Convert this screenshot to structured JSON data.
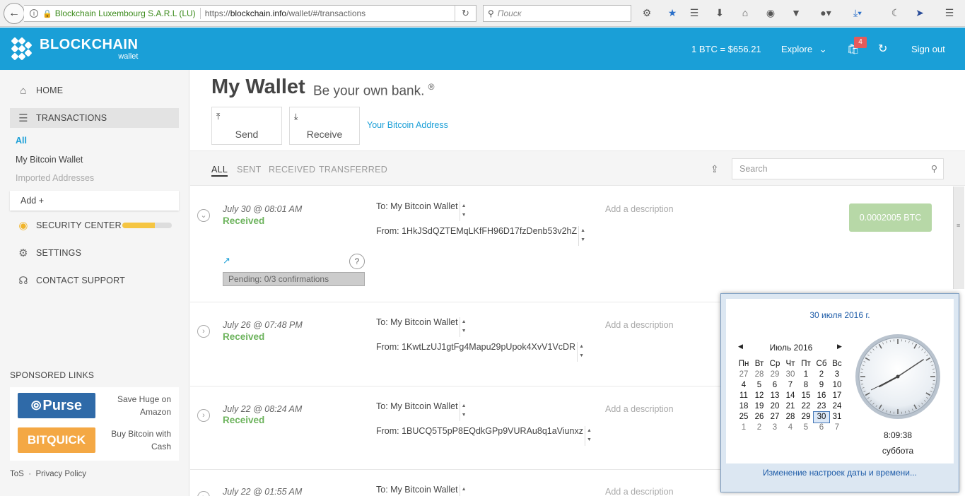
{
  "browser": {
    "org_label": "Blockchain Luxembourg S.A.R.L (LU)",
    "url_prefix": "https://",
    "url_domain": "blockchain.info",
    "url_path": "/wallet/#/transactions",
    "search_placeholder": "Поиск"
  },
  "header": {
    "brand": "BLOCKCHAIN",
    "brand_sub": "wallet",
    "price": "1 BTC =  $656.21",
    "explore": "Explore",
    "notifications": "4",
    "signout": "Sign out",
    "brand_color": "#1a9fd7"
  },
  "sidebar": {
    "home": "HOME",
    "transactions": "TRANSACTIONS",
    "sub_all": "All",
    "sub_wallet": "My Bitcoin Wallet",
    "sub_imported": "Imported Addresses",
    "add": "Add +",
    "security": "SECURITY CENTER",
    "security_progress": 0.65,
    "settings": "SETTINGS",
    "support": "CONTACT SUPPORT",
    "sponsored": "SPONSORED LINKS",
    "ad1_logo": "Purse",
    "ad1_text": "Save Huge on Amazon",
    "ad2_logo": "BITQUICK",
    "ad2_text": "Buy Bitcoin with Cash",
    "tos": "ToS",
    "privacy": "Privacy Policy"
  },
  "main": {
    "title": "My Wallet",
    "subtitle": "Be your own bank.",
    "registered": "®",
    "send": "Send",
    "receive": "Receive",
    "your_address": "Your Bitcoin Address",
    "filters": [
      "ALL",
      "SENT",
      "RECEIVED",
      "TRANSFERRED"
    ],
    "search_placeholder": "Search"
  },
  "transactions": [
    {
      "date": "July 30 @ 08:01 AM",
      "status": "Received",
      "to": "To: My Bitcoin Wallet",
      "from": "From: 1HkJSdQZTEMqLKfFH96D17fzDenb53v2hZ",
      "desc": "Add a description",
      "amount": "0.0002005 BTC",
      "pending": "Pending: 0/3 confirmations"
    },
    {
      "date": "July 26 @ 07:48 PM",
      "status": "Received",
      "to": "To: My Bitcoin Wallet",
      "from": "From: 1KwtLzUJ1gtFg4Mapu29pUpok4XvV1VcDR",
      "desc": "Add a description"
    },
    {
      "date": "July 22 @ 08:24 AM",
      "status": "Received",
      "to": "To: My Bitcoin Wallet",
      "from": "From: 1BUCQ5T5pP8EQdkGPp9VURAu8q1aViunxz",
      "desc": "Add a description"
    },
    {
      "date": "July 22 @ 01:55 AM",
      "to": "To: My Bitcoin Wallet",
      "desc": "Add a description"
    }
  ],
  "calendar": {
    "full_date": "30 июля 2016 г.",
    "month": "Июль 2016",
    "weekdays": [
      "Пн",
      "Вт",
      "Ср",
      "Чт",
      "Пт",
      "Сб",
      "Вс"
    ],
    "weeks": [
      [
        "27",
        "28",
        "29",
        "30",
        "1",
        "2",
        "3"
      ],
      [
        "4",
        "5",
        "6",
        "7",
        "8",
        "9",
        "10"
      ],
      [
        "11",
        "12",
        "13",
        "14",
        "15",
        "16",
        "17"
      ],
      [
        "18",
        "19",
        "20",
        "21",
        "22",
        "23",
        "24"
      ],
      [
        "25",
        "26",
        "27",
        "28",
        "29",
        "30",
        "31"
      ],
      [
        "1",
        "2",
        "3",
        "4",
        "5",
        "6",
        "7"
      ]
    ],
    "time": "8:09:38",
    "weekday": "суббота",
    "settings_link": "Изменение настроек даты и времени..."
  }
}
